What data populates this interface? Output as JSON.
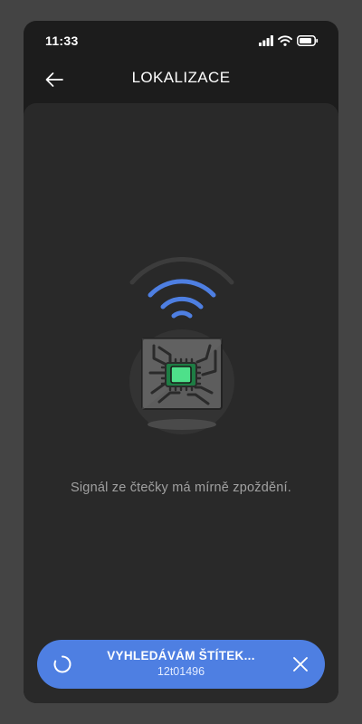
{
  "status_bar": {
    "time": "11:33",
    "icons": [
      "signal-icon",
      "wifi-icon",
      "battery-icon"
    ]
  },
  "header": {
    "title": "LOKALIZACE",
    "back_icon": "arrow-left-icon"
  },
  "main": {
    "illustration": "rfid-chip-signal-illustration",
    "message": "Signál ze čtečky má mírně zpoždění."
  },
  "search_banner": {
    "title": "VYHLEDÁVÁM ŠTÍTEK...",
    "tag_id": "12t01496",
    "spinner_icon": "loading-spinner-icon",
    "close_icon": "close-icon"
  },
  "colors": {
    "page_background": "#444444",
    "app_background": "#1c1c1c",
    "content_background": "#292929",
    "accent_blue": "#4e7fe2",
    "chip_green": "#2ecc71",
    "message_gray": "#a0a0a0"
  }
}
